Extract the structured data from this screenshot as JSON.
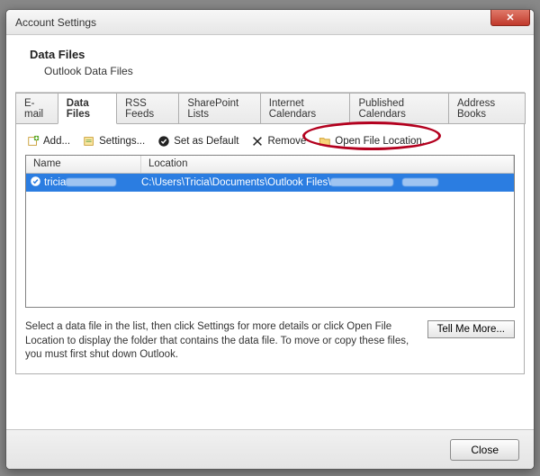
{
  "window": {
    "title": "Account Settings"
  },
  "header": {
    "title": "Data Files",
    "subtitle": "Outlook Data Files"
  },
  "tabs": [
    {
      "label": "E-mail"
    },
    {
      "label": "Data Files"
    },
    {
      "label": "RSS Feeds"
    },
    {
      "label": "SharePoint Lists"
    },
    {
      "label": "Internet Calendars"
    },
    {
      "label": "Published Calendars"
    },
    {
      "label": "Address Books"
    }
  ],
  "active_tab": 1,
  "toolbar": {
    "add": "Add...",
    "settings": "Settings...",
    "default": "Set as Default",
    "remove": "Remove",
    "open": "Open File Location..."
  },
  "columns": {
    "name": "Name",
    "location": "Location"
  },
  "rows": [
    {
      "name": "tricia",
      "location": "C:\\Users\\Tricia\\Documents\\Outlook Files\\"
    }
  ],
  "help_text": "Select a data file in the list, then click Settings for more details or click Open File Location to display the folder that contains the data file. To move or copy these files, you must first shut down Outlook.",
  "tell_me_more": "Tell Me More...",
  "close": "Close"
}
